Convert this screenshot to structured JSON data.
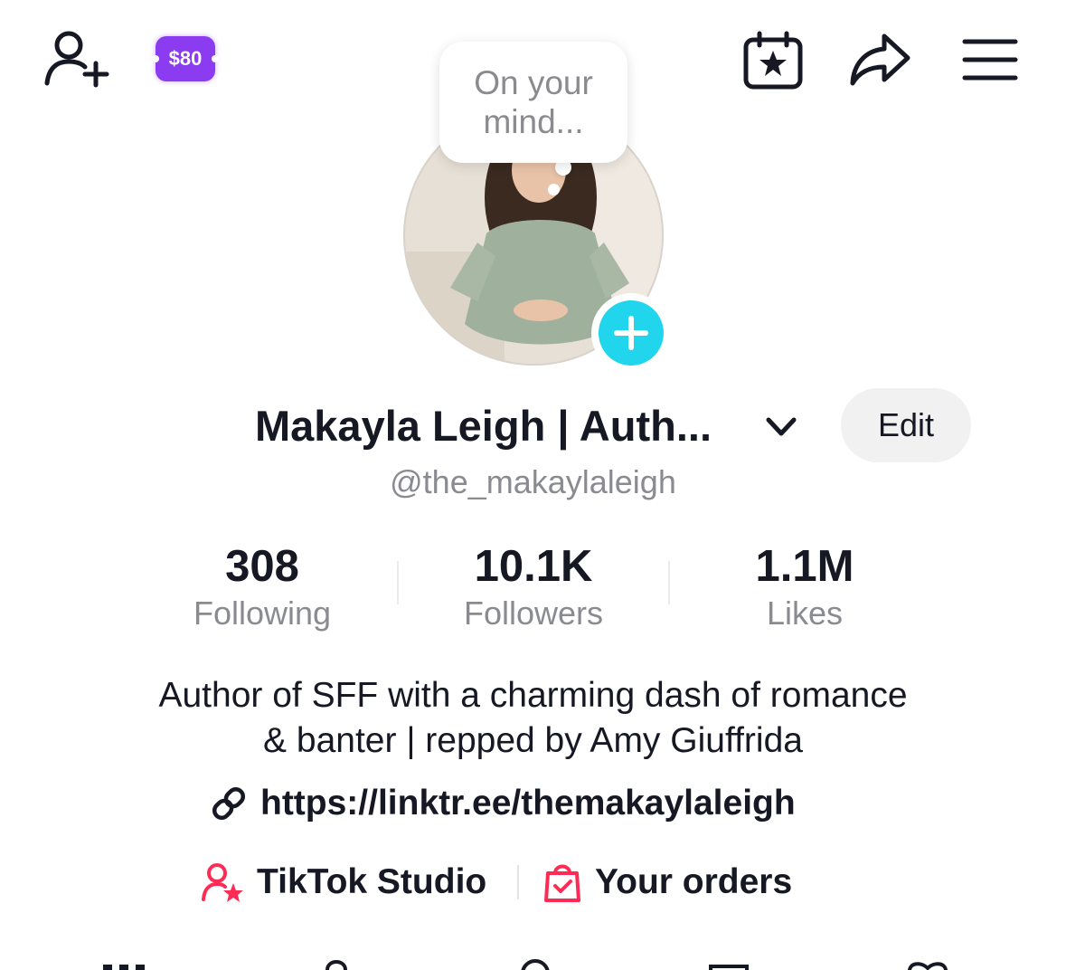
{
  "header": {
    "coupon_label": "$80"
  },
  "bubble": {
    "text": "On your mind..."
  },
  "profile": {
    "name": "Makayla Leigh | Auth...",
    "handle": "@the_makaylaleigh",
    "edit_label": "Edit"
  },
  "stats": [
    {
      "value": "308",
      "label": "Following"
    },
    {
      "value": "10.1K",
      "label": "Followers"
    },
    {
      "value": "1.1M",
      "label": "Likes"
    }
  ],
  "bio": {
    "line1": "Author of SFF with a charming dash of romance",
    "line2": "& banter | repped by Amy Giuffrida",
    "link": "https://linktr.ee/themakaylaleigh"
  },
  "shortcuts": {
    "studio_label": "TikTok Studio",
    "orders_label": "Your orders"
  },
  "colors": {
    "accent_cyan": "#20d5ec",
    "brand_pink": "#fe2c55",
    "coupon_purple": "#8b3cf0"
  },
  "icons": [
    "add-friend-icon",
    "coupon-icon",
    "calendar-star-icon",
    "share-icon",
    "menu-icon",
    "chevron-down-icon",
    "plus-icon",
    "link-icon",
    "studio-icon",
    "shopping-bag-icon"
  ]
}
